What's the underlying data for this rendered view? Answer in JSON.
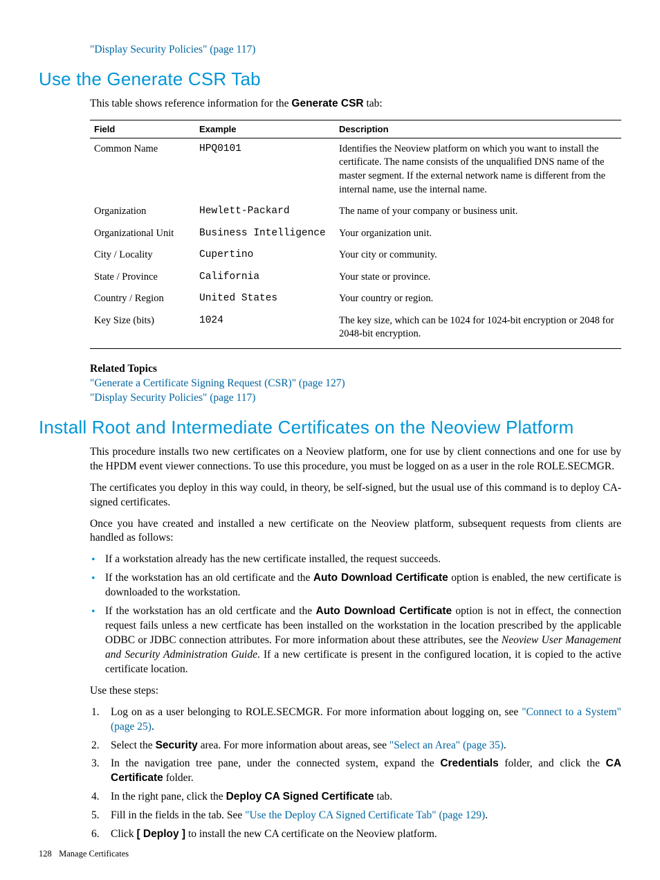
{
  "topLink": "\"Display Security Policies\" (page 117)",
  "heading1": "Use the Generate CSR Tab",
  "intro1_pre": "This table shows reference information for the ",
  "intro1_bold": "Generate CSR",
  "intro1_post": " tab:",
  "table": {
    "headers": {
      "field": "Field",
      "example": "Example",
      "description": "Description"
    },
    "rows": [
      {
        "field": "Common Name",
        "example": "HPQ0101",
        "description": "Identifies the Neoview platform on which you want to install the certificate. The name consists of the unqualified DNS name of the master segment. If the external network name is different from the internal name, use the internal name."
      },
      {
        "field": "Organization",
        "example": "Hewlett-Packard",
        "description": "The name of your company or business unit."
      },
      {
        "field": "Organizational Unit",
        "example": "Business Intelligence",
        "description": "Your organization unit."
      },
      {
        "field": "City / Locality",
        "example": "Cupertino",
        "description": "Your city or community."
      },
      {
        "field": "State / Province",
        "example": "California",
        "description": "Your state or province."
      },
      {
        "field": "Country / Region",
        "example": "United States",
        "description": "Your country or region."
      },
      {
        "field": "Key Size (bits)",
        "example": "1024",
        "description": "The key size, which can be 1024 for 1024-bit encryption or 2048 for 2048-bit encryption."
      }
    ]
  },
  "related1": {
    "heading": "Related Topics",
    "links": [
      "\"Generate a Certificate Signing Request (CSR)\" (page 127)",
      "\"Display Security Policies\" (page 117)"
    ]
  },
  "heading2": "Install Root and Intermediate Certificates on the Neoview Platform",
  "para1": "This procedure installs two new certificates on a Neoview platform, one for use by client connections and one for use by the HPDM event viewer connections. To use this procedure, you must be logged on as a user in the role ROLE.SECMGR.",
  "para2": "The certificates you deploy in this way could, in theory, be self-signed, but the usual use of this command is to deploy CA-signed certificates.",
  "para3": "Once you have created and installed a new certificate on the Neoview platform, subsequent requests from clients are handled as follows:",
  "bullets": {
    "b1": "If a workstation already has the new certificate installed, the request succeeds.",
    "b2_pre": "If the workstation has an old certificate and the ",
    "b2_bold": "Auto Download Certificate",
    "b2_post": " option is enabled, the new certificate is downloaded to the workstation.",
    "b3_pre": "If the workstation has an old certficate and the ",
    "b3_bold": "Auto Download Certificate",
    "b3_mid": " option is not in effect, the connection request fails unless a new certficate has been installed on the workstation in the location prescribed by the applicable ODBC or JDBC connection attributes. For more information about these attributes, see the ",
    "b3_italic": "Neoview User Management and Security Administration Guide",
    "b3_post": ". If a new certificate is present in the configured location, it is copied to the active certificate location."
  },
  "useSteps": "Use these steps:",
  "steps": {
    "s1_pre": "Log on as a user belonging to ROLE.SECMGR. For more information about logging on, see ",
    "s1_link": "\"Connect to a System\" (page 25)",
    "s1_post": ".",
    "s2_pre": "Select the ",
    "s2_bold": "Security",
    "s2_mid": " area. For more information about areas, see ",
    "s2_link": "\"Select an Area\" (page 35)",
    "s2_post": ".",
    "s3_pre": "In the navigation tree pane, under the connected system, expand the ",
    "s3_bold1": "Credentials",
    "s3_mid": " folder, and click the ",
    "s3_bold2": "CA Certificate",
    "s3_post": " folder.",
    "s4_pre": "In the right pane, click the ",
    "s4_bold": "Deploy CA Signed Certificate",
    "s4_post": " tab.",
    "s5_pre": "Fill in the fields in the tab. See ",
    "s5_link": "\"Use the Deploy CA Signed Certificate Tab\" (page 129)",
    "s5_post": ".",
    "s6_pre": "Click ",
    "s6_bold": "[ Deploy ]",
    "s6_post": " to install the new CA certificate on the Neoview platform."
  },
  "footer": {
    "pageNum": "128",
    "section": "Manage Certificates"
  }
}
